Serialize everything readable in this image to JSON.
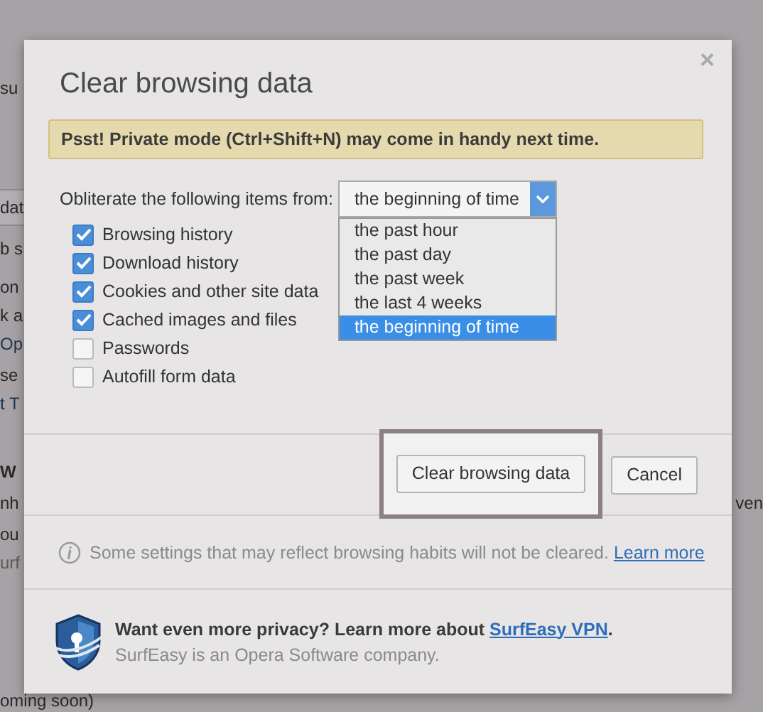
{
  "background_page": {
    "lines": [
      {
        "text": "su",
        "kind": "text"
      },
      {
        "text": "dat",
        "kind": "tab"
      },
      {
        "text": "b s",
        "kind": "text"
      },
      {
        "text": "on",
        "kind": "text"
      },
      {
        "text": "k a",
        "kind": "text"
      },
      {
        "text": "Op",
        "kind": "link"
      },
      {
        "text": "se",
        "kind": "text"
      },
      {
        "text": "t T",
        "kind": "link"
      },
      {
        "text": "W",
        "kind": "bold"
      },
      {
        "text": "nh",
        "kind": "text",
        "right": "ven"
      },
      {
        "text": "ou",
        "kind": "text"
      },
      {
        "text": "urf",
        "kind": "muted"
      },
      {
        "text": "oming soon)",
        "kind": "text"
      }
    ]
  },
  "dialog": {
    "title": "Clear browsing data",
    "close": "×",
    "notice": "Psst! Private mode (Ctrl+Shift+N) may come in handy next time.",
    "range_label": "Obliterate the following items from:",
    "range_select": {
      "value": "the beginning of time",
      "expanded": true,
      "options": [
        {
          "label": "the past hour",
          "selected": false
        },
        {
          "label": "the past day",
          "selected": false
        },
        {
          "label": "the past week",
          "selected": false
        },
        {
          "label": "the last 4 weeks",
          "selected": false
        },
        {
          "label": "the beginning of time",
          "selected": true
        }
      ]
    },
    "items": [
      {
        "label": "Browsing history",
        "checked": true
      },
      {
        "label": "Download history",
        "checked": true
      },
      {
        "label": "Cookies and other site data",
        "checked": true
      },
      {
        "label": "Cached images and files",
        "checked": true
      },
      {
        "label": "Passwords",
        "checked": false
      },
      {
        "label": "Autofill form data",
        "checked": false
      }
    ],
    "buttons": [
      {
        "label": "Clear browsing data",
        "highlighted": true
      },
      {
        "label": "Cancel",
        "highlighted": false
      }
    ],
    "info": {
      "text": "Some settings that may reflect browsing habits will not be cleared.",
      "link": "Learn more"
    },
    "promo": {
      "text": "Want even more privacy? Learn more about ",
      "link": "SurfEasy VPN",
      "after": ".",
      "subtext": "SurfEasy is an Opera Software company."
    }
  }
}
